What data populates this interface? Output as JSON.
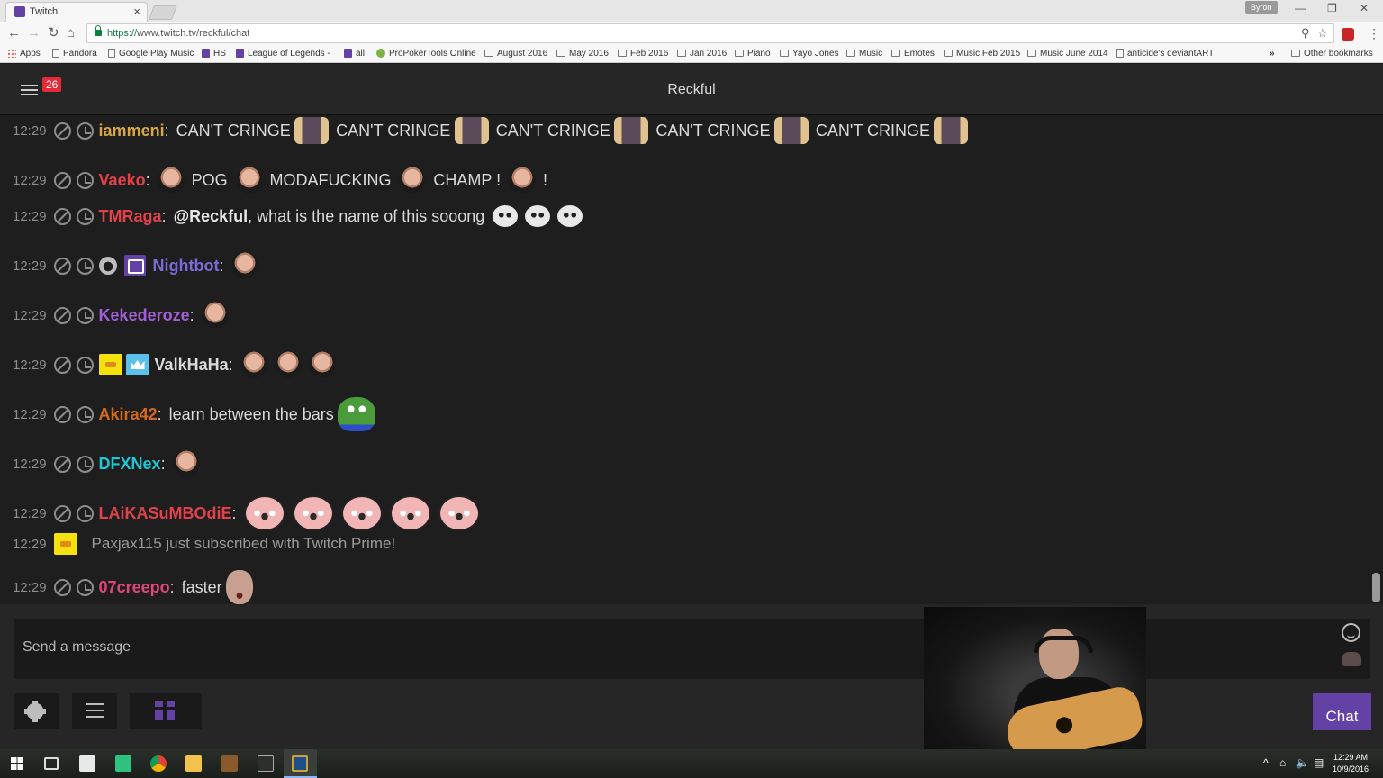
{
  "browser": {
    "tab_title": "Twitch",
    "tab_close": "×",
    "profile_name": "Byron",
    "url_secure": "https://",
    "url_rest": "www.twitch.tv/reckful/chat",
    "bookmarks": [
      {
        "label": "Apps",
        "icon": "apps"
      },
      {
        "label": "Pandora",
        "icon": "page"
      },
      {
        "label": "Google Play Music",
        "icon": "page"
      },
      {
        "label": "HS",
        "icon": "twitch"
      },
      {
        "label": "League of Legends - ",
        "icon": "twitch"
      },
      {
        "label": "all",
        "icon": "twitch"
      },
      {
        "label": "ProPokerTools Online",
        "icon": "ppt"
      },
      {
        "label": "August 2016",
        "icon": "folder"
      },
      {
        "label": "May 2016",
        "icon": "folder"
      },
      {
        "label": "Feb 2016",
        "icon": "folder"
      },
      {
        "label": "Jan 2016",
        "icon": "folder"
      },
      {
        "label": "Piano",
        "icon": "folder"
      },
      {
        "label": "Yayo Jones",
        "icon": "folder"
      },
      {
        "label": "Music",
        "icon": "folder"
      },
      {
        "label": "Emotes",
        "icon": "folder"
      },
      {
        "label": "Music Feb 2015",
        "icon": "folder"
      },
      {
        "label": "Music June 2014",
        "icon": "folder"
      },
      {
        "label": "anticide's deviantART",
        "icon": "page"
      }
    ],
    "more_bookmarks": "»",
    "other_bookmarks": "Other bookmarks"
  },
  "chat": {
    "channel": "Reckful",
    "notification_count": "26",
    "colors": {
      "purple": "#6441a5",
      "badge_red": "#e62937"
    },
    "messages": [
      {
        "time": "12:29",
        "user": "iammeni",
        "color": "#d8a942",
        "text": "CAN'T CRINGE",
        "repeat": 5
      },
      {
        "time": "12:29",
        "user": "Vaeko",
        "color": "#e0424a",
        "parts": [
          "POG",
          "MODAFUCKING",
          "CHAMP !",
          "!"
        ]
      },
      {
        "time": "12:29",
        "user": "TMRaga",
        "color": "#e0424a",
        "mention": "@Reckful",
        "text": ", what is the name of this sooong"
      },
      {
        "time": "12:29",
        "user": "Nightbot",
        "color": "#7b6bd6"
      },
      {
        "time": "12:29",
        "user": "Kekederoze",
        "color": "#a25fd6"
      },
      {
        "time": "12:29",
        "user": "ValkHaHa",
        "color": "#dadada"
      },
      {
        "time": "12:29",
        "user": "Akira42",
        "color": "#d2691e",
        "text": "learn between the bars"
      },
      {
        "time": "12:29",
        "user": "DFXNex",
        "color": "#1ec7d6"
      },
      {
        "time": "12:29",
        "user": "LAiKASuMBOdiE",
        "color": "#e0424a"
      },
      {
        "time": "12:29",
        "system": "Paxjax115 just subscribed with Twitch Prime!"
      },
      {
        "time": "12:29",
        "user": "07creepo",
        "color": "#e0457b",
        "text": "faster"
      }
    ],
    "input_placeholder": "Send a message",
    "send_label": "Chat"
  },
  "taskbar": {
    "clock_time": "12:29 AM",
    "clock_date": "10/9/2016"
  }
}
